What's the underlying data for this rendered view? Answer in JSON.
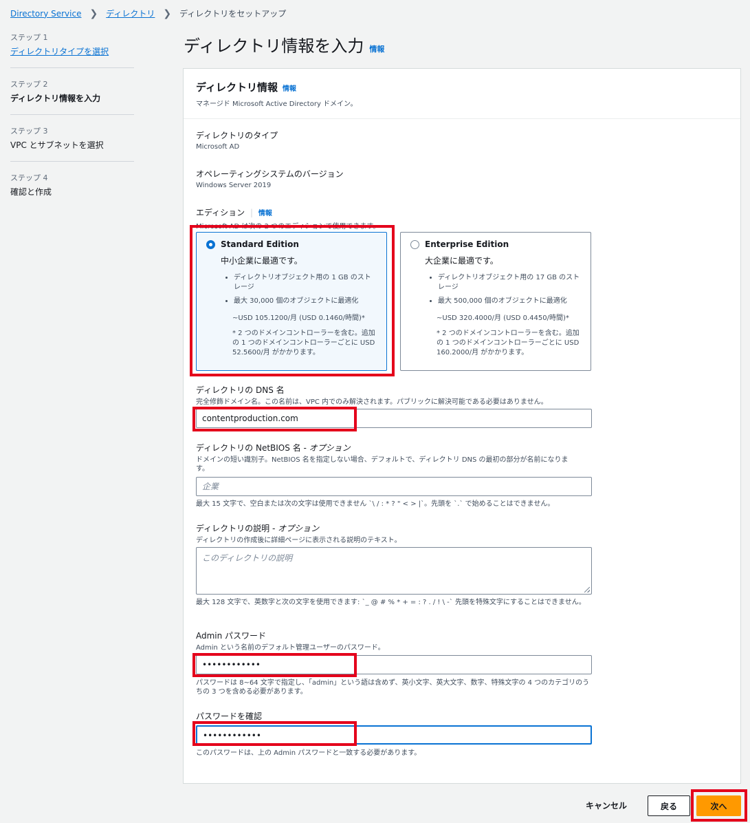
{
  "breadcrumb": {
    "items": [
      "Directory Service",
      "ディレクトリ"
    ],
    "current": "ディレクトリをセットアップ"
  },
  "steps": [
    {
      "num": "ステップ 1",
      "label": "ディレクトリタイプを選択"
    },
    {
      "num": "ステップ 2",
      "label": "ディレクトリ情報を入力"
    },
    {
      "num": "ステップ 3",
      "label": "VPC とサブネットを選択"
    },
    {
      "num": "ステップ 4",
      "label": "確認と作成"
    }
  ],
  "page": {
    "title": "ディレクトリ情報を入力",
    "info": "情報"
  },
  "panel": {
    "title": "ディレクトリ情報",
    "info": "情報",
    "description": "マネージド Microsoft Active Directory ドメイン。",
    "directory_type": {
      "label": "ディレクトリのタイプ",
      "value": "Microsoft AD"
    },
    "os_version": {
      "label": "オペレーティングシステムのバージョン",
      "value": "Windows Server 2019"
    },
    "edition": {
      "label": "エディション",
      "info": "情報",
      "description": "Microsoft AD は次の 2 つのエディションで使用できます。",
      "options": [
        {
          "name": "Standard Edition",
          "selected": true,
          "subtitle": "中小企業に最適です。",
          "bullets": [
            "ディレクトリオブジェクト用の 1 GB のストレージ",
            "最大 30,000 個のオブジェクトに最適化"
          ],
          "price": "~USD 105.1200/月 (USD 0.1460/時間)*",
          "note": "* 2 つのドメインコントローラーを含む。追加の 1 つのドメインコントローラーごとに USD 52.5600/月 がかかります。"
        },
        {
          "name": "Enterprise Edition",
          "selected": false,
          "subtitle": "大企業に最適です。",
          "bullets": [
            "ディレクトリオブジェクト用の 17 GB のストレージ",
            "最大 500,000 個のオブジェクトに最適化"
          ],
          "price": "~USD 320.4000/月 (USD 0.4450/時間)*",
          "note": "* 2 つのドメインコントローラーを含む。追加の 1 つのドメインコントローラーごとに USD 160.2000/月 がかかります。"
        }
      ]
    },
    "dns": {
      "label": "ディレクトリの DNS 名",
      "description": "完全修飾ドメイン名。この名前は、VPC 内でのみ解決されます。パブリックに解決可能である必要はありません。",
      "value": "contentproduction.com"
    },
    "netbios": {
      "label": "ディレクトリの NetBIOS 名",
      "optional": " - オプション",
      "description": "ドメインの短い識別子。NetBIOS 名を指定しない場合、デフォルトで、ディレクトリ DNS の最初の部分が名前になります。",
      "placeholder": "企業",
      "constraint": "最大 15 文字で、空白または次の文字は使用できません `\\ / : * ? \" < > |`。先頭を `.` で始めることはできません。"
    },
    "description_field": {
      "label": "ディレクトリの説明",
      "optional": " - オプション",
      "description": "ディレクトリの作成後に詳細ページに表示される説明のテキスト。",
      "placeholder": "このディレクトリの説明",
      "constraint": "最大 128 文字で、英数字と次の文字を使用できます: `_ @ # % * + = : ? . / ! \\ -` 先頭を特殊文字にすることはできません。"
    },
    "admin_password": {
      "label": "Admin パスワード",
      "description": "Admin という名前のデフォルト管理ユーザーのパスワード。",
      "value": "••••••••••••",
      "constraint": "パスワードは 8~64 文字で指定し、「admin」という語は含めず、英小文字、英大文字、数字、特殊文字の 4 つのカテゴリのうちの 3 つを含める必要があります。"
    },
    "confirm_password": {
      "label": "パスワードを確認",
      "value": "••••••••••••",
      "constraint": "このパスワードは、上の Admin パスワードと一致する必要があります。"
    }
  },
  "footer": {
    "cancel": "キャンセル",
    "back": "戻る",
    "next": "次へ"
  }
}
